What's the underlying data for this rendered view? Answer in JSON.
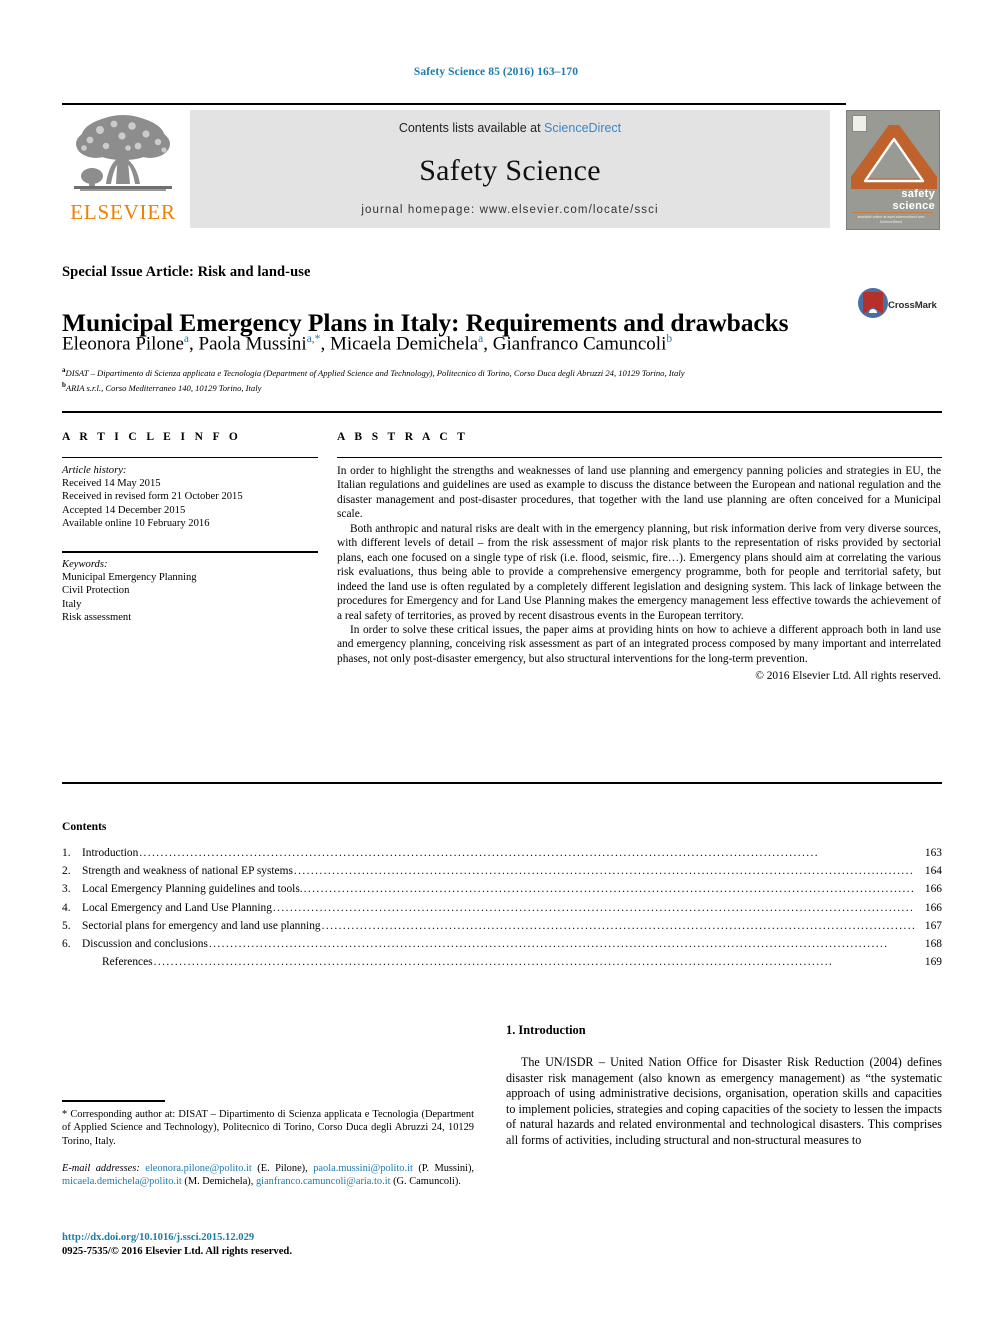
{
  "running_head": "Safety Science 85 (2016) 163–170",
  "masthead": {
    "contents_prefix": "Contents lists available at ",
    "sciencedirect": "ScienceDirect",
    "journal_title": "Safety Science",
    "homepage": "journal homepage: www.elsevier.com/locate/ssci"
  },
  "publisher": {
    "name": "ELSEVIER",
    "logo_color": "#f08000"
  },
  "cover": {
    "title_line1": "safety",
    "title_line2": "science",
    "footer_text": "available online at www.sciencedirect.com ScienceDirect",
    "bg_color": "#9a9a94",
    "accent_color": "#c0622c"
  },
  "crossmark": {
    "label": "CrossMark"
  },
  "article": {
    "special_issue": "Special Issue Article: Risk and land-use",
    "title": "Municipal Emergency Plans in Italy: Requirements and drawbacks",
    "authors": [
      {
        "name": "Eleonora Pilone",
        "marks": "a"
      },
      {
        "name": "Paola Mussini",
        "marks": "a,*"
      },
      {
        "name": "Micaela Demichela",
        "marks": "a"
      },
      {
        "name": "Gianfranco Camuncoli",
        "marks": "b"
      }
    ],
    "affiliations": [
      {
        "mark": "a",
        "text": "DISAT – Dipartimento di Scienza applicata e Tecnologia (Department of Applied Science and Technology), Politecnico di Torino, Corso Duca degli Abruzzi 24, 10129 Torino, Italy"
      },
      {
        "mark": "b",
        "text": "ARIA s.r.l., Corso Mediterraneo 140, 10129 Torino, Italy"
      }
    ]
  },
  "info": {
    "header": "A R T I C L E   I N F O",
    "history_label": "Article history:",
    "history": [
      "Received 14 May 2015",
      "Received in revised form 21 October 2015",
      "Accepted 14 December 2015",
      "Available online 10 February 2016"
    ],
    "keywords_label": "Keywords:",
    "keywords": [
      "Municipal Emergency Planning",
      "Civil Protection",
      "Italy",
      "Risk assessment"
    ]
  },
  "abstract": {
    "header": "A B S T R A C T",
    "paragraphs": [
      "In order to highlight the strengths and weaknesses of land use planning and emergency panning policies and strategies in EU, the Italian regulations and guidelines are used as example to discuss the distance between the European and national regulation and the disaster management and post-disaster procedures, that together with the land use planning are often conceived for a Municipal scale.",
      "Both anthropic and natural risks are dealt with in the emergency planning, but risk information derive from very diverse sources, with different levels of detail – from the risk assessment of major risk plants to the representation of risks provided by sectorial plans, each one focused on a single type of risk (i.e. flood, seismic, fire…). Emergency plans should aim at correlating the various risk evaluations, thus being able to provide a comprehensive emergency programme, both for people and territorial safety, but indeed the land use is often regulated by a completely different legislation and designing system. This lack of linkage between the procedures for Emergency and for Land Use Planning makes the emergency management less effective towards the achievement of a real safety of territories, as proved by recent disastrous events in the European territory.",
      "In order to solve these critical issues, the paper aims at providing hints on how to achieve a different approach both in land use and emergency planning, conceiving risk assessment as part of an integrated process composed by many important and interrelated phases, not only post-disaster emergency, but also structural interventions for the long-term prevention."
    ],
    "copyright": "© 2016 Elsevier Ltd. All rights reserved."
  },
  "contents": {
    "header": "Contents",
    "items": [
      {
        "num": "1.",
        "label": "Introduction",
        "page": "163"
      },
      {
        "num": "2.",
        "label": "Strength and weakness of national EP systems",
        "page": "164"
      },
      {
        "num": "3.",
        "label": "Local Emergency Planning guidelines and tools.",
        "page": "166"
      },
      {
        "num": "4.",
        "label": "Local Emergency and Land Use Planning",
        "page": "166"
      },
      {
        "num": "5.",
        "label": "Sectorial plans for emergency and land use planning",
        "page": "167"
      },
      {
        "num": "6.",
        "label": "Discussion and conclusions",
        "page": "168"
      },
      {
        "num": "",
        "label": "References",
        "page": "169"
      }
    ]
  },
  "footnote": {
    "corresponding": "* Corresponding author at: DISAT – Dipartimento di Scienza applicata e Tecnologia (Department of Applied Science and Technology), Politecnico di Torino, Corso Duca degli Abruzzi 24, 10129 Torino, Italy.",
    "emails_label": "E-mail addresses:",
    "emails": [
      {
        "address": "eleonora.pilone@polito.it",
        "person": "(E. Pilone),"
      },
      {
        "address": "paola.mussini@polito.it",
        "person": "(P. Mussini),"
      },
      {
        "address": "micaela.demichela@polito.it",
        "person": "(M. Demichela),"
      },
      {
        "address": "gianfranco.camuncoli@aria.to.it",
        "person": "(G. Camuncoli)."
      }
    ],
    "doi": "http://dx.doi.org/10.1016/j.ssci.2015.12.029",
    "issn": "0925-7535/© 2016 Elsevier Ltd. All rights reserved."
  },
  "introduction": {
    "heading": "1. Introduction",
    "paragraph": "The UN/ISDR – United Nation Office for Disaster Risk Reduction (2004) defines disaster risk management (also known as emergency management) as “the systematic approach of using administrative decisions, organisation, operation skills and capacities to implement policies, strategies and coping capacities of the society to lessen the impacts of natural hazards and related environmental and technological disasters. This comprises all forms of activities, including structural and non-structural measures to"
  }
}
